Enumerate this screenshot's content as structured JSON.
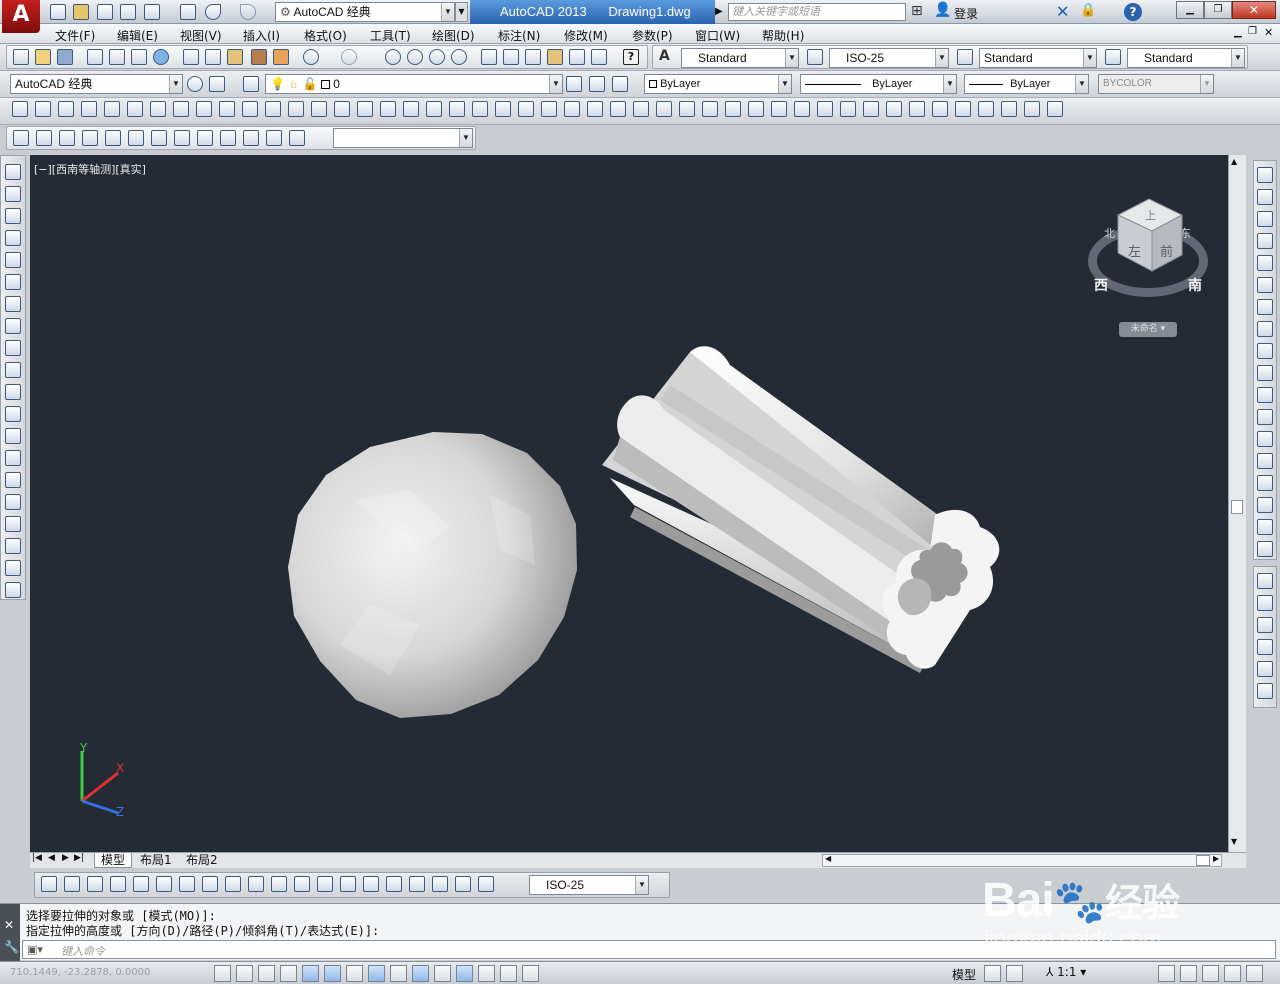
{
  "app": {
    "title": "AutoCAD 2013",
    "document": "Drawing1.dwg",
    "workspace": "AutoCAD 经典",
    "search_placeholder": "键入关键字或短语",
    "login_label": "登录"
  },
  "menu": [
    "文件(F)",
    "编辑(E)",
    "视图(V)",
    "插入(I)",
    "格式(O)",
    "工具(T)",
    "绘图(D)",
    "标注(N)",
    "修改(M)",
    "参数(P)",
    "窗口(W)",
    "帮助(H)"
  ],
  "styles": {
    "text_style": "Standard",
    "dim_style": "ISO-25",
    "table_style": "Standard",
    "mleader_style": "Standard"
  },
  "layers": {
    "workspace_combo": "AutoCAD 经典",
    "current_layer": "0",
    "color": "ByLayer",
    "linetype": "ByLayer",
    "lineweight": "ByLayer",
    "plotstyle": "BYCOLOR"
  },
  "viewport": {
    "label": "[−][西南等轴测][真实]",
    "background": "#252b35",
    "viewcube": {
      "top_face": "上",
      "front_face": "前",
      "left_face": "左",
      "compass_west": "西",
      "compass_south": "南",
      "compass_north": "北",
      "compass_east": "东",
      "ucs_label": "未命名"
    },
    "ucs_axes": {
      "x": "X",
      "y": "Y",
      "z": "Z"
    }
  },
  "tabs": [
    "模型",
    "布局1",
    "布局2"
  ],
  "dim_toolbar": {
    "style": "ISO-25"
  },
  "command": {
    "history_1": "选择要拉伸的对象或 [模式(MO)]:",
    "history_2": "指定拉伸的高度或 [方向(D)/路径(P)/倾斜角(T)/表达式(E)]:",
    "prompt_placeholder": "键入命令"
  },
  "status": {
    "coords": "710.1449, -23.2878, 0.0000",
    "model_label": "模型",
    "annotation_scale": "1:1"
  },
  "watermark": {
    "brand": "Bai",
    "brand2": "经验",
    "url": "jingyan.baidu.com"
  }
}
